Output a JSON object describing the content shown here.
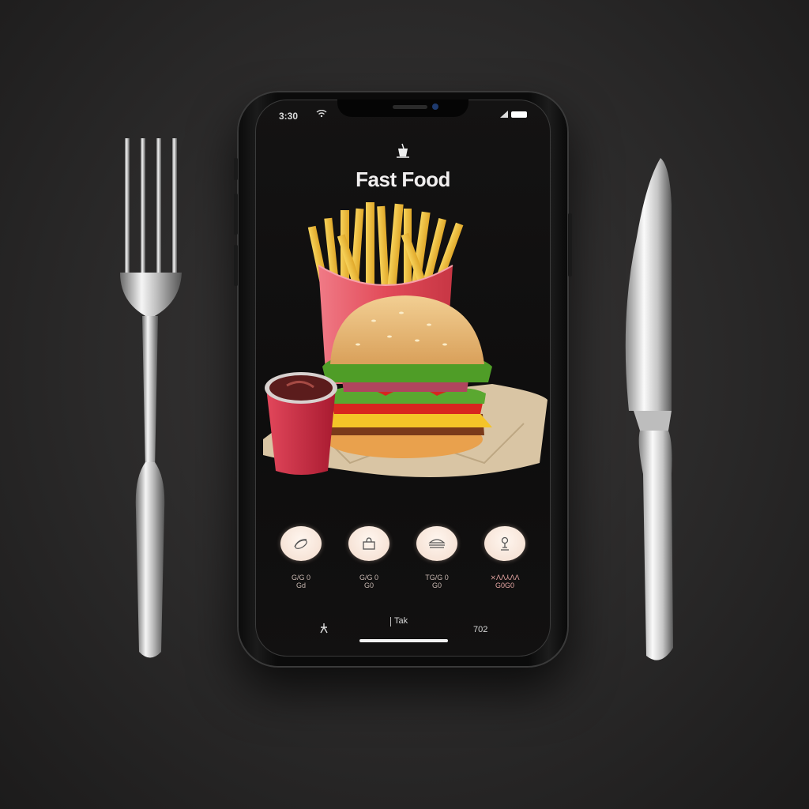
{
  "status": {
    "time": "3:30"
  },
  "app": {
    "title": "Fast Food",
    "icon": "cup-icon"
  },
  "categories": [
    {
      "icon": "hotdog-icon",
      "label": "G/G 0\nGd",
      "accent": false
    },
    {
      "icon": "bag-icon",
      "label": "G/G 0\nG0",
      "accent": false
    },
    {
      "icon": "burger-icon",
      "label": "TG/G 0\nG0",
      "accent": false
    },
    {
      "icon": "person-icon",
      "label": "⨯ΛΛ⅄ΛΛ\nG0G0",
      "accent": true
    }
  ],
  "tabbar": {
    "left_icon": "run-icon",
    "middle_label": "Tak",
    "right_label": "702"
  },
  "colors": {
    "fries_box": "#e24b59",
    "sauce_cup": "#c8243a",
    "background": "#2a2929"
  }
}
